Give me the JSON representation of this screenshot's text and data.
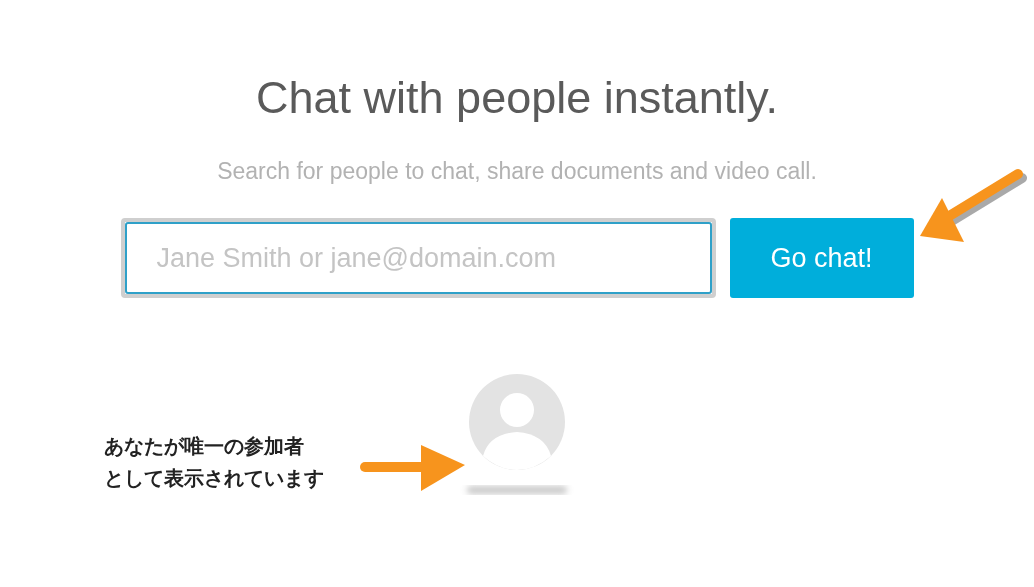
{
  "heading": "Chat with people instantly.",
  "subtitle": "Search for people to chat, share documents and video call.",
  "search": {
    "placeholder": "Jane Smith or jane@domain.com"
  },
  "button": "Go chat!",
  "annotation": {
    "lines": [
      "あなたが唯一の参加者",
      "として表示されています"
    ]
  }
}
